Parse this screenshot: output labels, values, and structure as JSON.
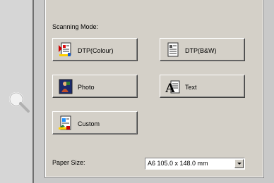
{
  "scanning_mode": {
    "label": "Scanning Mode:",
    "buttons": [
      {
        "label": "DTP(Colour)",
        "icon": "dtp-colour-icon"
      },
      {
        "label": "DTP(B&W)",
        "icon": "dtp-bw-icon"
      },
      {
        "label": "Photo",
        "icon": "photo-icon"
      },
      {
        "label": "Text",
        "icon": "text-icon"
      },
      {
        "label": "Custom",
        "icon": "custom-icon"
      }
    ]
  },
  "paper_size": {
    "label": "Paper Size:",
    "value": "A6 105.0 x 148.0 mm"
  },
  "left_panel": {
    "icon": "magnifier-icon"
  }
}
